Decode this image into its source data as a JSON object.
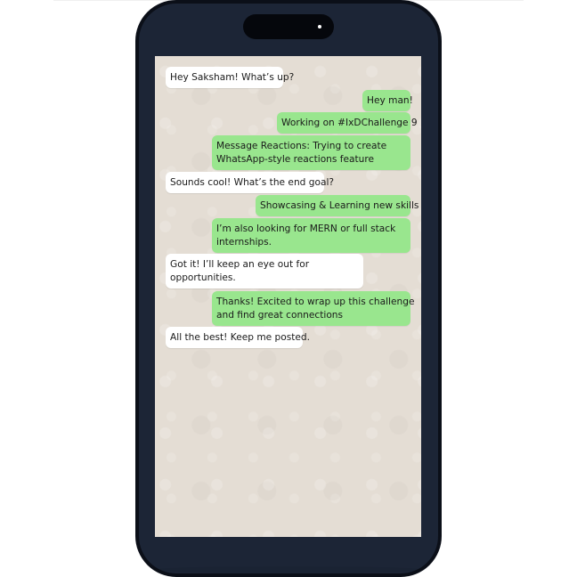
{
  "chat": {
    "messages": [
      {
        "direction": "incoming",
        "lines": [
          "Hey Saksham! What’s up?"
        ]
      },
      {
        "direction": "outgoing",
        "lines": [
          "Hey man!"
        ]
      },
      {
        "direction": "outgoing",
        "lines": [
          "Working on #IxDChallenge 9"
        ]
      },
      {
        "direction": "outgoing",
        "lines": [
          "Message Reactions: Trying to create",
          "WhatsApp-style reactions feature"
        ]
      },
      {
        "direction": "incoming",
        "lines": [
          "Sounds cool! What’s the end goal?"
        ]
      },
      {
        "direction": "outgoing",
        "lines": [
          "Showcasing & Learning new skills"
        ]
      },
      {
        "direction": "outgoing",
        "lines": [
          "I’m also looking for MERN or full stack",
          "internships."
        ]
      },
      {
        "direction": "incoming",
        "lines": [
          "Got it! I’ll keep an eye out for",
          "opportunities."
        ]
      },
      {
        "direction": "outgoing",
        "lines": [
          "Thanks! Excited to wrap up this challenge",
          "and find great connections"
        ]
      },
      {
        "direction": "incoming",
        "lines": [
          "All the best! Keep me posted."
        ]
      }
    ]
  },
  "colors": {
    "incoming_bubble": "#ffffff",
    "outgoing_bubble": "#99e68e",
    "chat_background": "#e4ddd4",
    "phone_frame": "#1c2536"
  }
}
